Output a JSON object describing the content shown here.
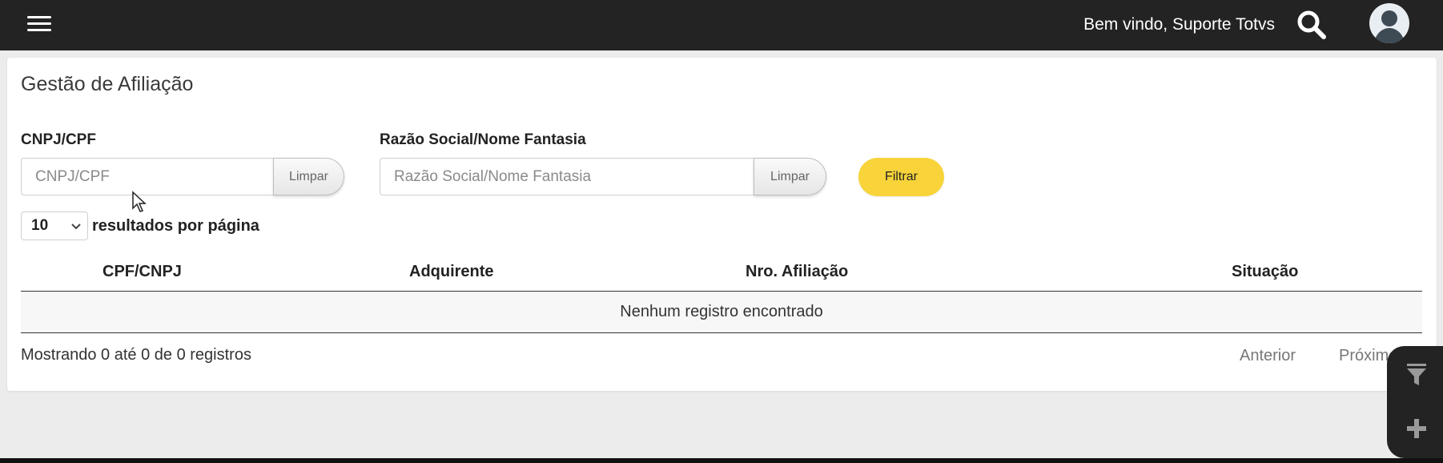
{
  "header": {
    "welcome_text": "Bem vindo, Suporte Totvs",
    "menu_icon": "hamburger-icon",
    "search_icon": "search-icon",
    "avatar_icon": "user-avatar-icon"
  },
  "page": {
    "title": "Gestão de Afiliação"
  },
  "filters": {
    "cnpj_label": "CNPJ/CPF",
    "cnpj_placeholder": "CNPJ/CPF",
    "cnpj_value": "",
    "cnpj_clear": "Limpar",
    "razao_label": "Razão Social/Nome Fantasia",
    "razao_placeholder": "Razão Social/Nome Fantasia",
    "razao_value": "",
    "razao_clear": "Limpar",
    "filter_button": "Filtrar",
    "filter_color": "#f8d43a"
  },
  "pagination_size": {
    "selected": "10",
    "label": "resultados por página"
  },
  "table": {
    "columns": [
      "CPF/CNPJ",
      "Adquirente",
      "Nro. Afiliação",
      "Situação"
    ],
    "rows": [],
    "empty_message": "Nenhum registro encontrado"
  },
  "footer": {
    "info": "Mostrando 0 até 0 de 0 registros",
    "previous": "Anterior",
    "next": "Próximo"
  },
  "side_panel": {
    "icons": [
      "filter-icon",
      "plus-icon"
    ]
  },
  "colors": {
    "topbar": "#232323",
    "accent": "#f8d43a"
  }
}
